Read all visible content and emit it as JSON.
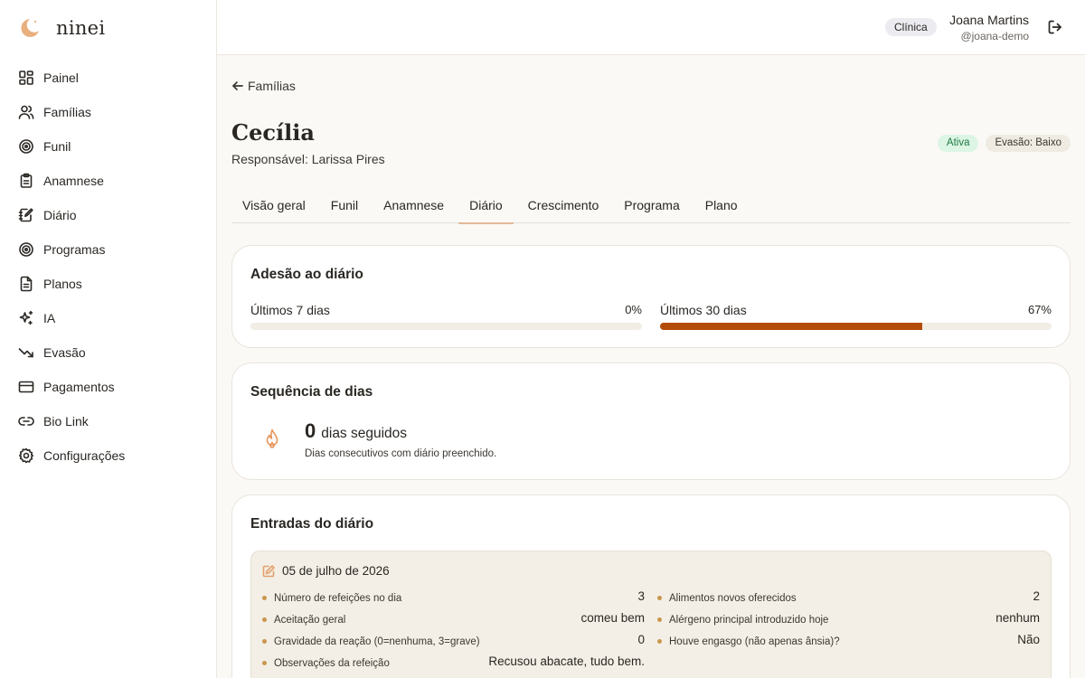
{
  "app": {
    "name": "ninei"
  },
  "sidebar": {
    "items": [
      {
        "label": "Painel",
        "icon": "dashboard-icon"
      },
      {
        "label": "Famílias",
        "icon": "users-icon"
      },
      {
        "label": "Funil",
        "icon": "target-icon"
      },
      {
        "label": "Anamnese",
        "icon": "clipboard-icon"
      },
      {
        "label": "Diário",
        "icon": "notebook-pen-icon"
      },
      {
        "label": "Programas",
        "icon": "target-icon"
      },
      {
        "label": "Planos",
        "icon": "document-icon"
      },
      {
        "label": "IA",
        "icon": "sparkles-icon"
      },
      {
        "label": "Evasão",
        "icon": "trending-down-icon"
      },
      {
        "label": "Pagamentos",
        "icon": "credit-card-icon"
      },
      {
        "label": "Bio Link",
        "icon": "link-icon"
      },
      {
        "label": "Configurações",
        "icon": "gear-icon"
      }
    ]
  },
  "topbar": {
    "role": "Clínica",
    "user_name": "Joana Martins",
    "user_handle": "@joana-demo",
    "logout_icon": "logout-icon"
  },
  "page": {
    "back_label": "Famílias",
    "title": "Cecília",
    "responsible": "Responsável: Larissa Pires",
    "status": "Ativa",
    "evasion": "Evasão: Baixo",
    "tabs": [
      "Visão geral",
      "Funil",
      "Anamnese",
      "Diário",
      "Crescimento",
      "Programa",
      "Plano"
    ],
    "active_tab": "Diário"
  },
  "adesao": {
    "title": "Adesão ao diário",
    "last7": {
      "label": "Últimos 7 dias",
      "percent_text": "0%",
      "value": 0
    },
    "last30": {
      "label": "Últimos 30 dias",
      "percent_text": "67%",
      "value": 67
    },
    "fill_color": "#b34b0a"
  },
  "sequencia": {
    "title": "Sequência de dias",
    "count": "0",
    "unit": "dias seguidos",
    "description": "Dias consecutivos com diário preenchido.",
    "icon": "flame-icon"
  },
  "entradas": {
    "title": "Entradas do diário",
    "entries": [
      {
        "date": "05 de julho de 2026",
        "left": [
          {
            "label": "Número de refeições no dia",
            "value": "3"
          },
          {
            "label": "Aceitação geral",
            "value": "comeu bem"
          },
          {
            "label": "Gravidade da reação (0=nenhuma, 3=grave)",
            "value": "0"
          },
          {
            "label": "Observações da refeição",
            "value": "Recusou abacate, tudo bem."
          }
        ],
        "right": [
          {
            "label": "Alimentos novos oferecidos",
            "value": "2"
          },
          {
            "label": "Alérgeno principal introduzido hoje",
            "value": "nenhum"
          },
          {
            "label": "Houve engasgo (não apenas ânsia)?",
            "value": "Não"
          }
        ]
      }
    ]
  }
}
